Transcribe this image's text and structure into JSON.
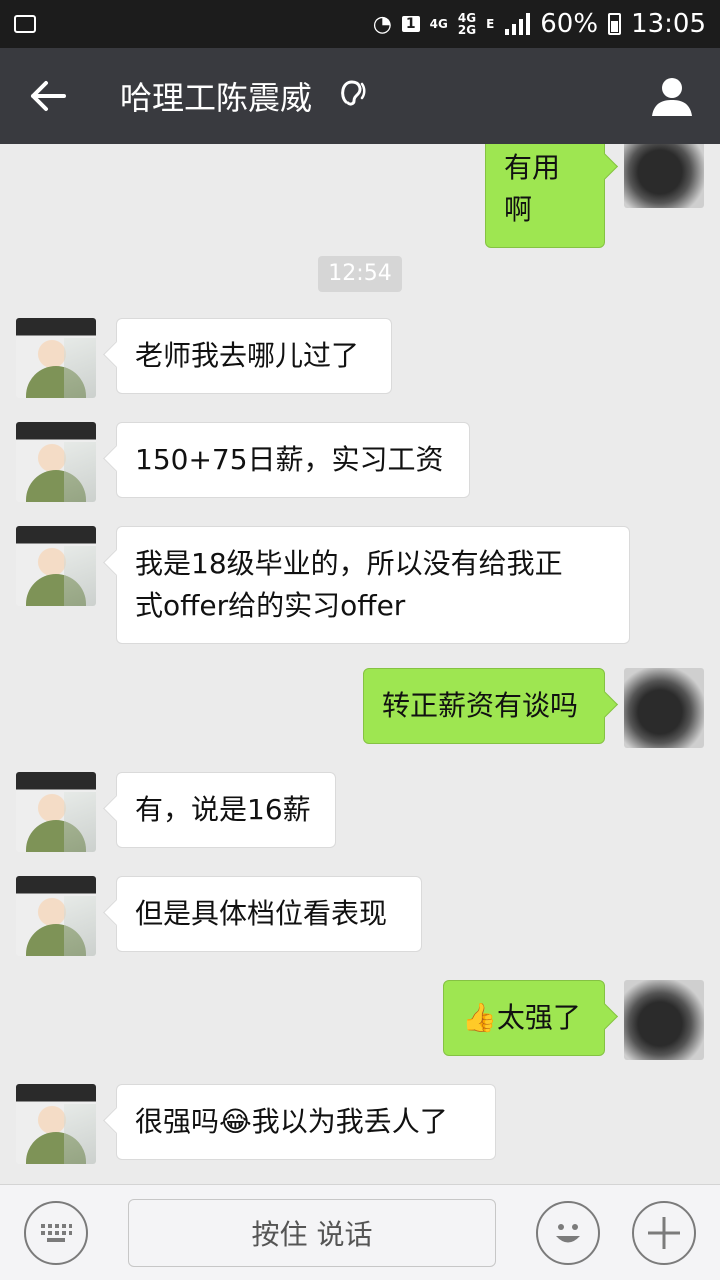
{
  "status_bar": {
    "sim": "1",
    "net_4g": "4G",
    "net_4g2g_top": "4G",
    "net_4g2g_bottom": "2G",
    "net_e": "E",
    "battery": "60%",
    "time": "13:05"
  },
  "header": {
    "title": "哈理工陈震威"
  },
  "chat": {
    "timestamp": "12:54",
    "messages": [
      {
        "side": "right",
        "text": "有用啊"
      },
      {
        "side": "left",
        "text": "老师我去哪儿过了"
      },
      {
        "side": "left",
        "text": "150+75日薪，实习工资"
      },
      {
        "side": "left",
        "text": "我是18级毕业的，所以没有给我正\n式offer给的实习offer"
      },
      {
        "side": "right",
        "text": "转正薪资有谈吗"
      },
      {
        "side": "left",
        "text": "有，说是16薪"
      },
      {
        "side": "left",
        "text": "但是具体档位看表现"
      },
      {
        "side": "right",
        "emoji": "👍",
        "text": "太强了"
      },
      {
        "side": "left",
        "text_before": "很强吗",
        "emoji": "😂",
        "text_after": "我以为我丢人了"
      }
    ]
  },
  "input_bar": {
    "hold_to_talk": "按住 说话"
  },
  "icons": {
    "back": "back-arrow-icon",
    "earpiece": "earpiece-mode-icon",
    "profile": "profile-icon",
    "keyboard": "keyboard-icon",
    "emoji": "emoji-icon",
    "more": "plus-icon"
  },
  "colors": {
    "titlebar": "#393a3f",
    "statusbar": "#1c1c1c",
    "chat_bg": "#ebebeb",
    "bubble_right": "#9ee651",
    "bubble_left": "#ffffff"
  }
}
